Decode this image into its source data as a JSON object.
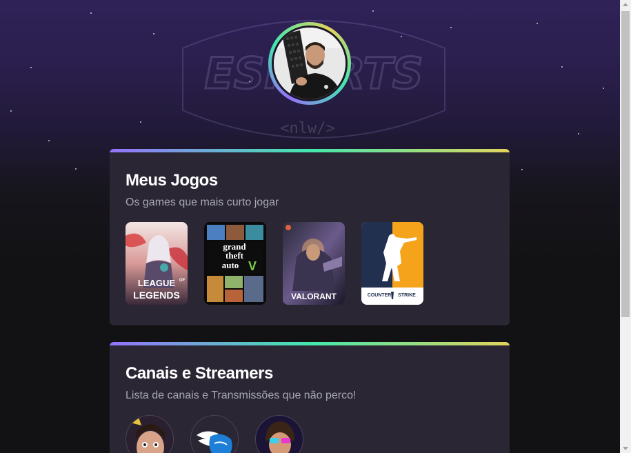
{
  "background": {
    "logo_text": "ESPORTS",
    "tag_text": "<nlw/>"
  },
  "profile": {
    "avatar_icon": "person-avatar",
    "ring_colors": [
      "#9572fc",
      "#43e7ad",
      "#e2d45c"
    ]
  },
  "games_section": {
    "title": "Meus Jogos",
    "subtitle": "Os games que mais curto jogar",
    "games": [
      {
        "name": "LEAGUE OF LEGENDS",
        "label_top": "LEAGUE",
        "label_of": "OF",
        "label_bottom": "LEGENDS"
      },
      {
        "name": "Grand Theft Auto V",
        "label_1": "grand",
        "label_2": "theft",
        "label_3": "auto",
        "label_4": "V"
      },
      {
        "name": "VALORANT",
        "label": "VALORANT"
      },
      {
        "name": "COUNTER STRIKE",
        "label_1": "COUNTER",
        "label_2": "STRIKE"
      }
    ]
  },
  "channels_section": {
    "title": "Canais e Streamers",
    "subtitle": "Lista de canais e Transmissões que não perco!",
    "channels": [
      {
        "icon": "streamer-face-avatar"
      },
      {
        "icon": "winged-hand-logo"
      },
      {
        "icon": "cartoon-streamer-avatar"
      }
    ]
  },
  "colors": {
    "accent_purple": "#9572fc",
    "accent_green": "#43e7ad",
    "accent_yellow": "#e2d45c",
    "card_bg": "#2a2634",
    "page_bg": "#121214"
  }
}
